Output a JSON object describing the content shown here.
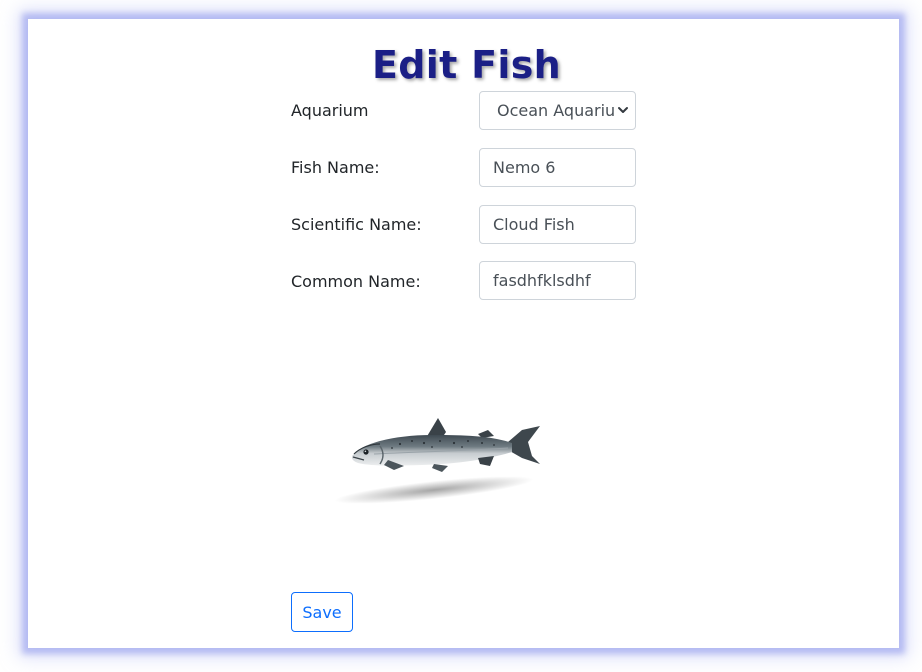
{
  "page": {
    "title": "Edit Fish"
  },
  "form": {
    "aquarium": {
      "label": "Aquarium",
      "selected": "Ocean Aquariu"
    },
    "fish_name": {
      "label": "Fish Name:",
      "value": "Nemo 6"
    },
    "scientific_name": {
      "label": "Scientific Name:",
      "value": "Cloud Fish"
    },
    "common_name": {
      "label": "Common Name:",
      "value": "fasdhfklsdhf"
    }
  },
  "image": {
    "subject": "salmon-fish"
  },
  "actions": {
    "save_label": "Save"
  },
  "colors": {
    "title": "#1b1f86",
    "primary": "#0d6efd",
    "card_glow": "#8c96eb"
  }
}
